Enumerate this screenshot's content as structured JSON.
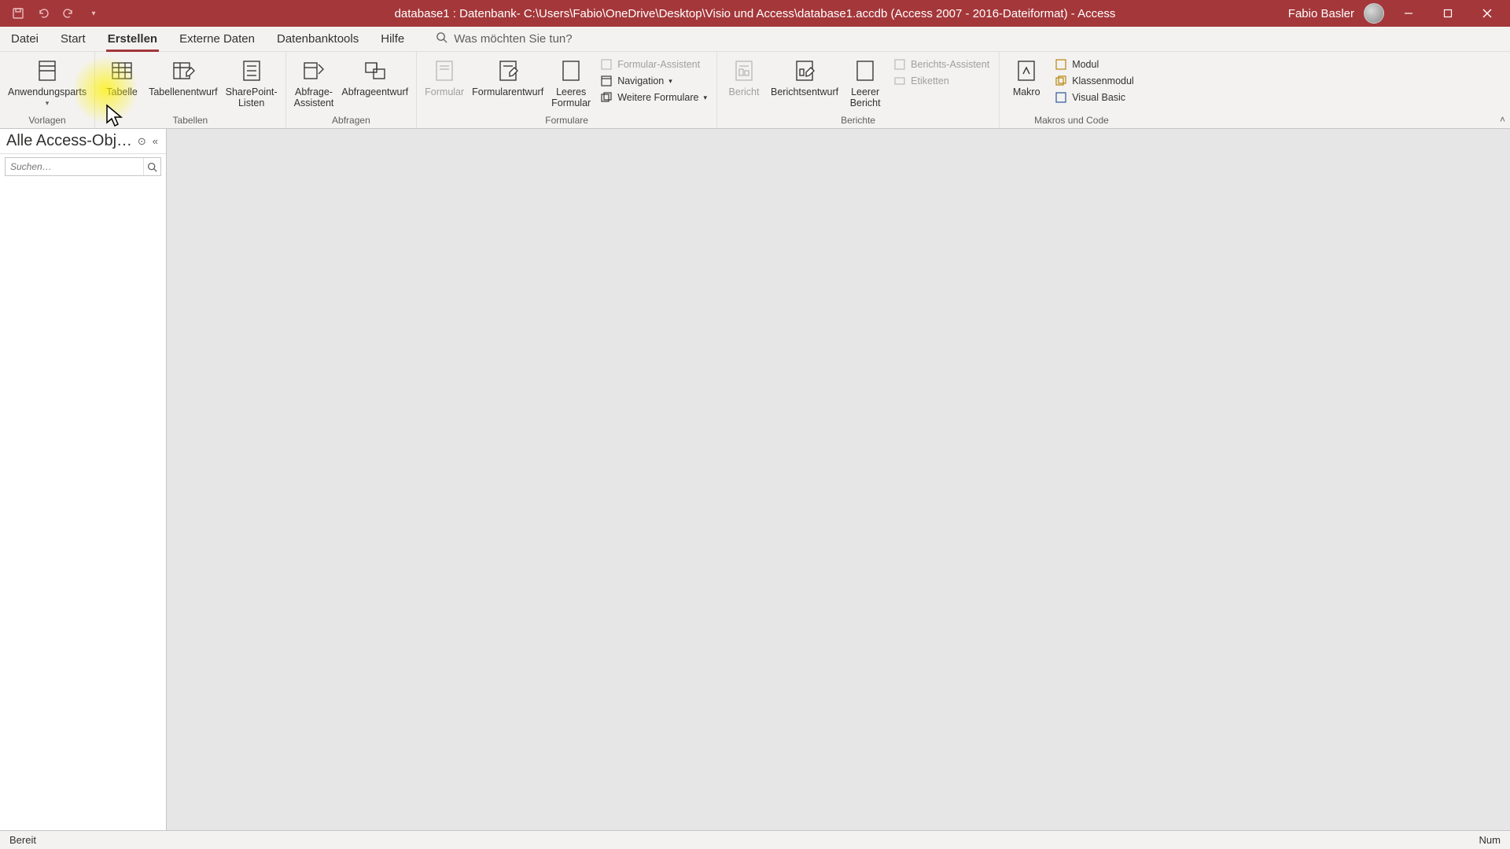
{
  "titlebar": {
    "title": "database1 : Datenbank- C:\\Users\\Fabio\\OneDrive\\Desktop\\Visio und Access\\database1.accdb (Access 2007 - 2016-Dateiformat)  -  Access",
    "user_name": "Fabio Basler"
  },
  "tabs": {
    "items": [
      {
        "id": "datei",
        "label": "Datei"
      },
      {
        "id": "start",
        "label": "Start"
      },
      {
        "id": "erstellen",
        "label": "Erstellen"
      },
      {
        "id": "externe-daten",
        "label": "Externe Daten"
      },
      {
        "id": "datenbanktools",
        "label": "Datenbanktools"
      },
      {
        "id": "hilfe",
        "label": "Hilfe"
      }
    ],
    "active": "erstellen",
    "tellme_placeholder": "Was möchten Sie tun?"
  },
  "ribbon": {
    "groups": {
      "vorlagen": {
        "label": "Vorlagen",
        "anwendungsparts": "Anwendungsparts"
      },
      "tabellen": {
        "label": "Tabellen",
        "tabelle": "Tabelle",
        "tabellenentwurf": "Tabellenentwurf",
        "sharepoint": "SharePoint-\nListen"
      },
      "abfragen": {
        "label": "Abfragen",
        "assistent": "Abfrage-\nAssistent",
        "entwurf": "Abfrageentwurf"
      },
      "formulare": {
        "label": "Formulare",
        "formular": "Formular",
        "formularentwurf": "Formularentwurf",
        "leeres": "Leeres\nFormular",
        "assistent": "Formular-Assistent",
        "navigation": "Navigation",
        "weitere": "Weitere Formulare"
      },
      "berichte": {
        "label": "Berichte",
        "bericht": "Bericht",
        "berichtsentwurf": "Berichtsentwurf",
        "leerer": "Leerer\nBericht",
        "assistent": "Berichts-Assistent",
        "etiketten": "Etiketten"
      },
      "makros": {
        "label": "Makros und Code",
        "makro": "Makro",
        "modul": "Modul",
        "klassenmodul": "Klassenmodul",
        "visualbasic": "Visual Basic"
      }
    }
  },
  "nav": {
    "title": "Alle Access-Obj…",
    "search_placeholder": "Suchen…"
  },
  "statusbar": {
    "left": "Bereit",
    "right": "Num"
  }
}
